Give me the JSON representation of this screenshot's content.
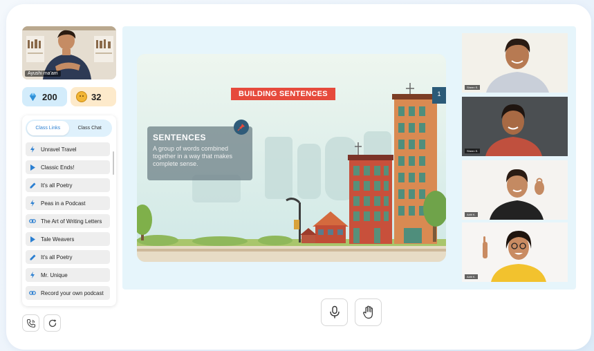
{
  "teacher": {
    "name": "Ayushi ma'am"
  },
  "stats": {
    "gems": "200",
    "coins": "32"
  },
  "tabs": [
    {
      "label": "Class Links",
      "active": true
    },
    {
      "label": "Class Chat",
      "active": false
    }
  ],
  "links": [
    {
      "icon": "lightning-icon",
      "label": "Unravel Travel"
    },
    {
      "icon": "play-icon",
      "label": "Classic Ends!"
    },
    {
      "icon": "pencil-icon",
      "label": "It's all Poetry"
    },
    {
      "icon": "lightning-icon",
      "label": "Peas in a Podcast"
    },
    {
      "icon": "link-icon",
      "label": "The Art of Writing Letters"
    },
    {
      "icon": "play-icon",
      "label": "Tale Weavers"
    },
    {
      "icon": "pencil-icon",
      "label": "It's all Poetry"
    },
    {
      "icon": "lightning-icon",
      "label": "Mr. Unique"
    },
    {
      "icon": "link-icon",
      "label": "Record your own podcast"
    }
  ],
  "slide": {
    "title": "BUILDING SENTENCES",
    "page": "1",
    "card_heading": "SENTENCES",
    "card_text": "A group of words combined together in a way that makes complete sense."
  },
  "participants": [
    {
      "name": "Sheen S."
    },
    {
      "name": "Sheen S."
    },
    {
      "name": "Aditi K."
    },
    {
      "name": "Aditi K."
    }
  ],
  "colors": {
    "accent": "#2b7fd1",
    "slide_title_bg": "#e64a3c",
    "stage_bg": "#e6f5fb"
  }
}
